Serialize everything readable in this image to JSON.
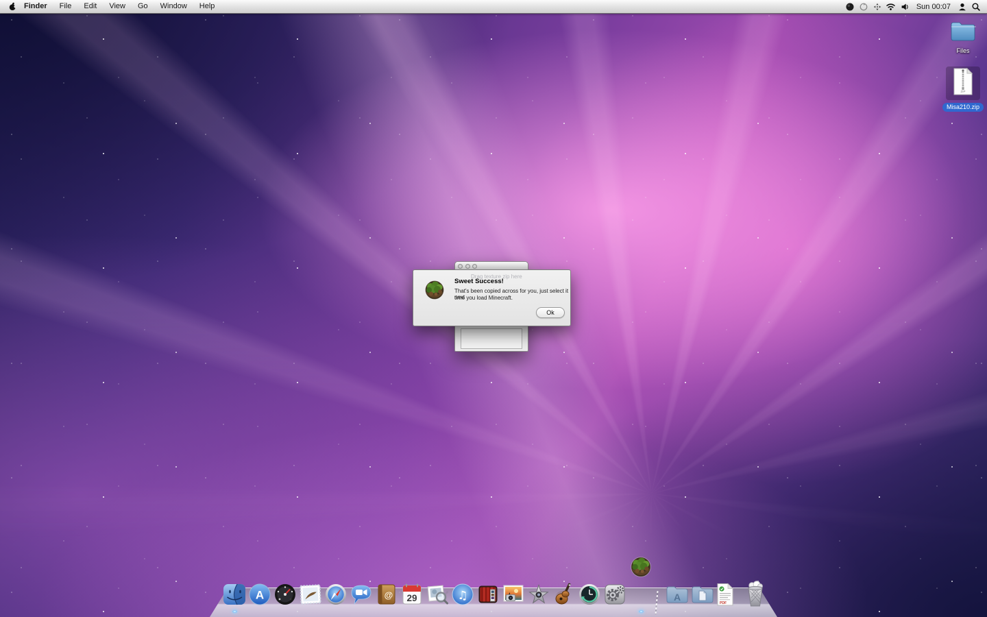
{
  "menu_bar": {
    "active_app": "Finder",
    "menus": [
      "Finder",
      "File",
      "Edit",
      "View",
      "Go",
      "Window",
      "Help"
    ],
    "clock": "Sun 00:07",
    "status_icons": [
      "dark-circle-status-icon",
      "sync-status-icon",
      "airport-scan-icon",
      "wifi-icon",
      "volume-icon"
    ]
  },
  "desktop_icons": {
    "files_folder": {
      "label": "Files"
    },
    "zip_file": {
      "label": "Misa210.zip",
      "badge": "ZIP",
      "selected": true
    }
  },
  "background_window": {
    "hint_text": "Drag texture zip here"
  },
  "dialog": {
    "title": "Sweet Success!",
    "body_line1": "That's been copied across for you, just select it next",
    "body_line2": "time you load Minecraft.",
    "ok_label": "Ok",
    "app_icon": "minecraft-globe-icon"
  },
  "dock": {
    "items": [
      "Finder",
      "App Store",
      "Dashboard",
      "Mail",
      "Safari",
      "iChat",
      "Address Book",
      "iCal",
      "Preview",
      "iTunes",
      "Photo Booth",
      "iPhoto",
      "iMovie",
      "GarageBand",
      "Time Machine",
      "System Preferences",
      "Applications",
      "Documents",
      "PDF Document",
      "Trash"
    ],
    "running": [
      "Finder",
      "Minecraft"
    ],
    "glyphs": {
      "app_store": "A",
      "address_book": "@",
      "ical_date": "29",
      "itunes": "♫",
      "pdf": "PDF",
      "apps_folder": "A"
    }
  },
  "colors": {
    "selection_blue": "#3068cf",
    "dialog_bg": "#ececec",
    "menu_text": "#1a1a1a",
    "dock_indicator": "#79c2f8",
    "wallpaper_magenta": "#a14cb0"
  }
}
